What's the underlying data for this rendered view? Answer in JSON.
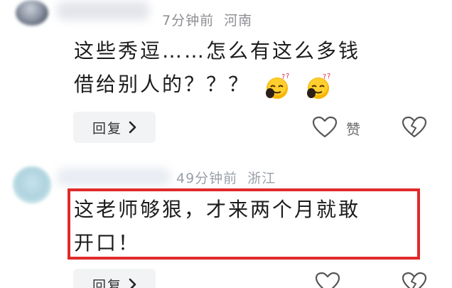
{
  "comments": [
    {
      "time": "7分钟前",
      "location": "河南",
      "text_line1": "这些秀逗……怎么有这么多钱",
      "text_line2": "借给别人的？？？",
      "emoji_icons": [
        "dizzy-face-emoji-icon",
        "dizzy-face-emoji-icon"
      ],
      "reply_label": "回复",
      "like_label": "赞"
    },
    {
      "time": "49分钟前",
      "location": "浙江",
      "text_line1": "这老师够狠，才来两个月就敢",
      "text_line2": "开口！",
      "reply_label": "回复",
      "highlight_color": "#e02a2a"
    }
  ],
  "colors": {
    "meta_text": "#8e8e93",
    "body_text": "#1c1c1c",
    "reply_bg": "#f2f3f5",
    "highlight": "#e02a2a"
  }
}
